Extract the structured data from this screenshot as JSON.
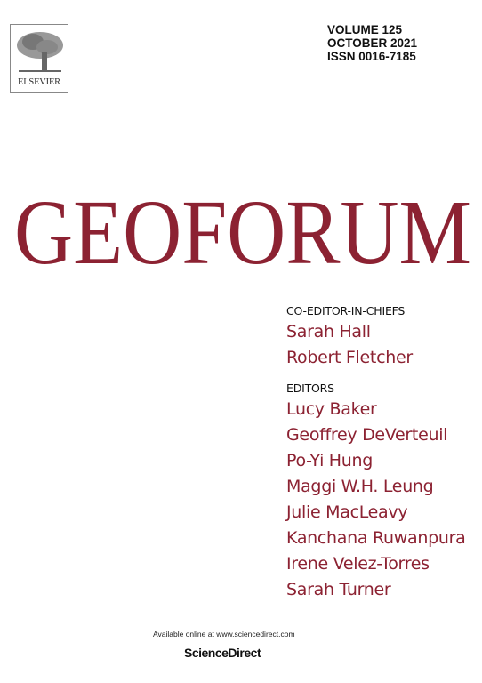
{
  "publisher": {
    "logo_text": "ELSEVIER"
  },
  "issue": {
    "volume": "VOLUME 125",
    "date": "OCTOBER 2021",
    "issn": "ISSN 0016-7185"
  },
  "journal_title": "GEOFORUM",
  "colors": {
    "accent": "#8c2232"
  },
  "co_editors": {
    "label": "CO-EDITOR-IN-CHIEFS",
    "names": [
      "Sarah Hall",
      "Robert Fletcher"
    ]
  },
  "editors": {
    "label": "EDITORS",
    "names": [
      "Lucy Baker",
      "Geoffrey DeVerteuil",
      "Po-Yi Hung",
      "Maggi W.H. Leung",
      "Julie MacLeavy",
      "Kanchana Ruwanpura",
      "Irene Velez-Torres",
      "Sarah Turner"
    ]
  },
  "footer": {
    "available": "Available online at www.sciencedirect.com",
    "platform": "ScienceDirect"
  }
}
